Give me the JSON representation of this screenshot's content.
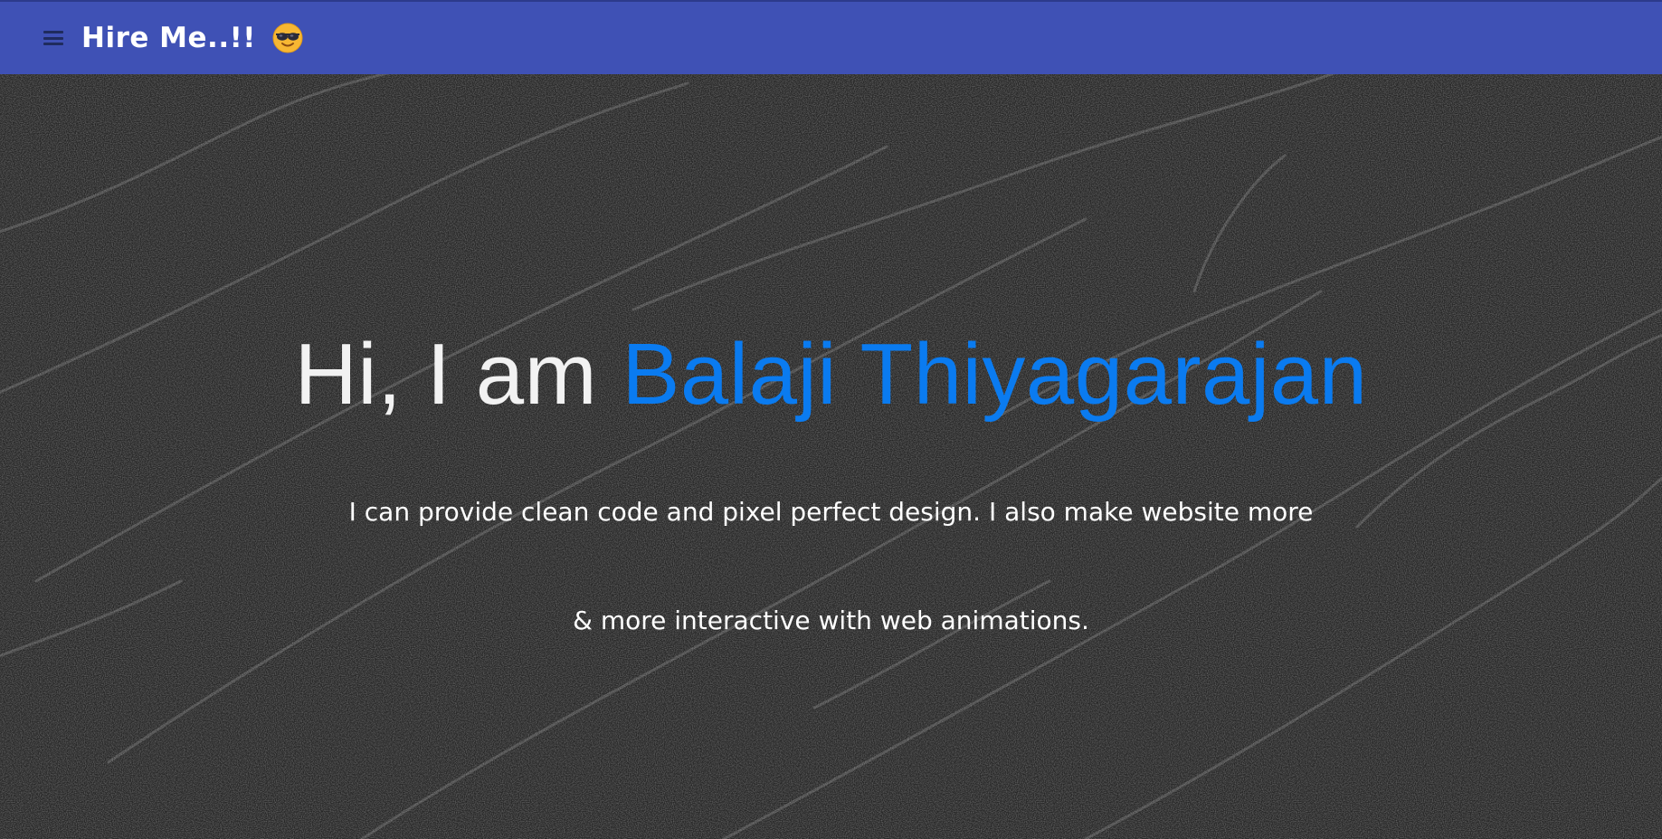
{
  "header": {
    "brand": "Hire Me..!!",
    "menu_icon": "hamburger-menu-icon",
    "emoji_icon": "sunglasses-emoji-icon",
    "bar_color": "#3f51b5"
  },
  "hero": {
    "greeting": "Hi, I am ",
    "name": "Balaji Thiyagarajan",
    "name_color": "#0a7bf0",
    "line1": "I can provide clean code and pixel perfect design. I also make website more",
    "line2": "& more interactive with web animations."
  }
}
